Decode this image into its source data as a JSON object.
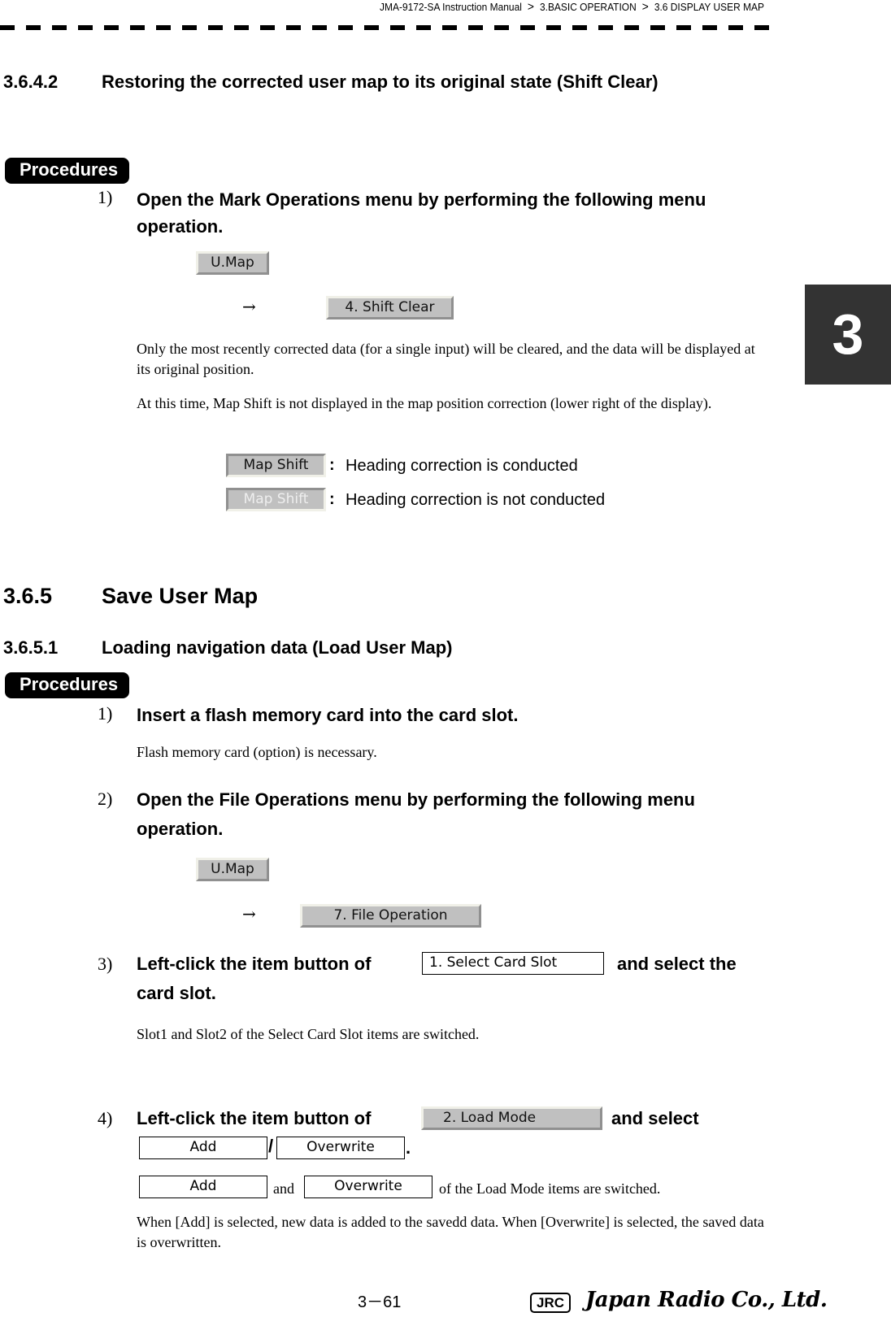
{
  "header": {
    "breadcrumb": [
      "JMA-9172-SA Instruction Manual",
      "3.BASIC OPERATION",
      "3.6  DISPLAY USER MAP"
    ],
    "separator": ">"
  },
  "chapter_tab": "3",
  "section_3_6_4_2": {
    "number": "3.6.4.2",
    "title": "Restoring the corrected user map to its original state (Shift Clear)",
    "procedures_label": "Procedures",
    "step1": {
      "num": "1)",
      "text": "Open the Mark Operations menu by performing the following menu operation.",
      "button1": "U.Map",
      "arrow": "→",
      "button2": "4. Shift Clear"
    },
    "para1": "Only the most recently corrected data (for a single input) will be cleared, and the data will be displayed at its original position.",
    "para2": "At this time,  Map Shift  is not displayed in the map position correction (lower right of the display).",
    "legend": [
      {
        "button": "Map Shift",
        "colon": ":",
        "text": "Heading correction is conducted"
      },
      {
        "button": "Map Shift",
        "colon": ":",
        "text": "Heading correction is not conducted"
      }
    ]
  },
  "section_3_6_5": {
    "number": "3.6.5",
    "title": "Save User Map"
  },
  "section_3_6_5_1": {
    "number": "3.6.5.1",
    "title": "Loading navigation data (Load User Map)",
    "procedures_label": "Procedures",
    "step1": {
      "num": "1)",
      "text": "Insert a flash memory card into the card slot.",
      "note": "Flash memory card (option) is necessary."
    },
    "step2": {
      "num": "2)",
      "text": "Open the File Operations menu by performing the following menu operation.",
      "button1": "U.Map",
      "arrow": "→",
      "button2": "7. File Operation"
    },
    "step3": {
      "num": "3)",
      "text_before": "Left-click the item button of",
      "button": "1. Select Card Slot",
      "text_after": "and select the",
      "text_line2": "card slot.",
      "note": "Slot1 and Slot2 of the Select Card Slot items are switched."
    },
    "step4": {
      "num": "4)",
      "text_before": "Left-click the item button of",
      "button": "2. Load Mode",
      "text_after": "and select",
      "option1": "Add",
      "slash": "/",
      "option2": "Overwrite",
      "period": ".",
      "note_and": "and",
      "note_after": "of the Load Mode items are switched.",
      "note2": "When [Add] is selected, new data is added to the savedd data. When [Overwrite] is selected, the saved data is overwritten."
    }
  },
  "footer": {
    "page": "3－61",
    "logo_badge": "JRC",
    "company": "Japan Radio Co., Ltd."
  }
}
